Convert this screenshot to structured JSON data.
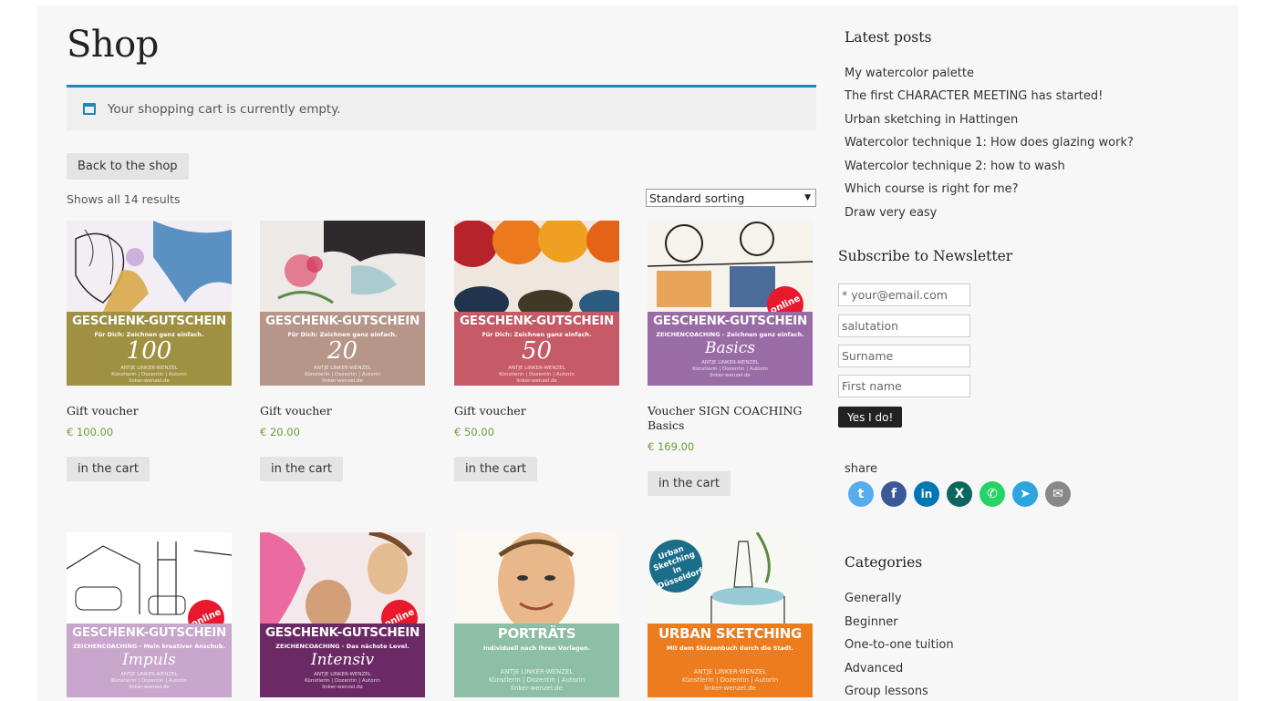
{
  "shop": {
    "title": "Shop",
    "notice": "Your shopping cart is currently empty.",
    "back_button": "Back to the shop",
    "results": "Shows all 14 results",
    "sort_selected": "Standard sorting"
  },
  "products": [
    {
      "name": "Gift voucher",
      "price": "€ 100.00",
      "button": "in the cart",
      "img": {
        "heading": "GESCHENK-GUTSCHEIN",
        "sub": "Für Dich: Zeichnen ganz einfach.",
        "value": "100",
        "foot1": "ANTJE LINKER-WENZEL",
        "foot2": "Künstlerin | Dozentin | Autorin",
        "foot3": "linker-wenzel.de",
        "band_color": "#a09142"
      }
    },
    {
      "name": "Gift voucher",
      "price": "€ 20.00",
      "button": "in the cart",
      "img": {
        "heading": "GESCHENK-GUTSCHEIN",
        "sub": "Für Dich: Zeichnen ganz einfach.",
        "value": "20",
        "foot1": "ANTJE LINKER-WENZEL",
        "foot2": "Künstlerin | Dozentin | Autorin",
        "foot3": "linker-wenzel.de",
        "band_color": "#b7968a"
      }
    },
    {
      "name": "Gift voucher",
      "price": "€ 50.00",
      "button": "in the cart",
      "img": {
        "heading": "GESCHENK-GUTSCHEIN",
        "sub": "Für Dich: Zeichnen ganz einfach.",
        "value": "50",
        "foot1": "ANTJE LINKER-WENZEL",
        "foot2": "Künstlerin | Dozentin | Autorin",
        "foot3": "linker-wenzel.de",
        "band_color": "#c65a66"
      }
    },
    {
      "name": "Voucher SIGN COACHING Basics",
      "price": "€ 169.00",
      "button": "in the cart",
      "img": {
        "heading": "GESCHENK-GUTSCHEIN",
        "sub": "ZEICHENCOACHING - Zeichnen ganz einfach.",
        "value": "Basics",
        "foot1": "ANTJE LINKER-WENZEL",
        "foot2": "Künstlerin | Dozentin | Autorin",
        "foot3": "linker-wenzel.de",
        "band_color": "#9a6ca6",
        "badge": "online"
      }
    },
    {
      "img": {
        "heading": "GESCHENK-GUTSCHEIN",
        "sub": "ZEICHENCOACHING - Mein kreativer Anschub.",
        "value": "Impuls",
        "foot1": "ANTJE LINKER-WENZEL",
        "foot2": "Künstlerin | Dozentin | Autorin",
        "foot3": "linker-wenzel.de",
        "band_color": "#c9a6cc",
        "badge": "online"
      }
    },
    {
      "img": {
        "heading": "GESCHENK-GUTSCHEIN",
        "sub": "ZEICHENCOACHING - Das nächste Level.",
        "value": "Intensiv",
        "foot1": "ANTJE LINKER-WENZEL",
        "foot2": "Künstlerin | Dozentin | Autorin",
        "foot3": "linker-wenzel.de",
        "band_color": "#6b2a66",
        "badge": "online"
      }
    },
    {
      "img": {
        "heading": "PORTRÄTS",
        "sub": "Individuell nach Ihren Vorlagen.",
        "foot1": "ANTJE LINKER-WENZEL",
        "foot2": "Künstlerin | Dozentin | Autorin",
        "foot3": "linker-wenzel.de",
        "band_color": "#8cbfa5"
      }
    },
    {
      "img": {
        "heading": "URBAN SKETCHING",
        "sub": "Mit dem Skizzenbuch durch die Stadt.",
        "foot1": "ANTJE LINKER-WENZEL",
        "foot2": "Künstlerin | Dozentin | Autorin",
        "foot3": "linker-wenzel.de",
        "band_color": "#ec7c1d",
        "badge": "Urban Sketching in Düsseldorf"
      }
    }
  ],
  "sidebar": {
    "latest_posts_title": "Latest posts",
    "posts": [
      "My watercolor palette",
      "The first CHARACTER MEETING has started!",
      "Urban sketching in Hattingen",
      "Watercolor technique 1: How does glazing work?",
      "Watercolor technique 2: how to wash",
      "Which course is right for me?",
      "Draw very easy"
    ],
    "newsletter_title": "Subscribe to Newsletter",
    "newsletter_fields": [
      "* your@email.com",
      "salutation",
      "Surname",
      "First name"
    ],
    "newsletter_button": "Yes I do!",
    "share_label": "share",
    "share_icons": [
      {
        "name": "twitter-icon",
        "glyph": "t",
        "color": "#55acee"
      },
      {
        "name": "facebook-icon",
        "glyph": "f",
        "color": "#3b5998"
      },
      {
        "name": "linkedin-icon",
        "glyph": "in",
        "color": "#0077b5"
      },
      {
        "name": "xing-icon",
        "glyph": "X",
        "color": "#0b6760"
      },
      {
        "name": "whatsapp-icon",
        "glyph": "✆",
        "color": "#25d366"
      },
      {
        "name": "telegram-icon",
        "glyph": "➤",
        "color": "#2ca5e0"
      },
      {
        "name": "email-icon",
        "glyph": "✉",
        "color": "#888888"
      }
    ],
    "categories_title": "Categories",
    "categories": [
      "Generally",
      "Beginner",
      "One-to-one tuition",
      "Advanced",
      "Group lessons"
    ]
  }
}
